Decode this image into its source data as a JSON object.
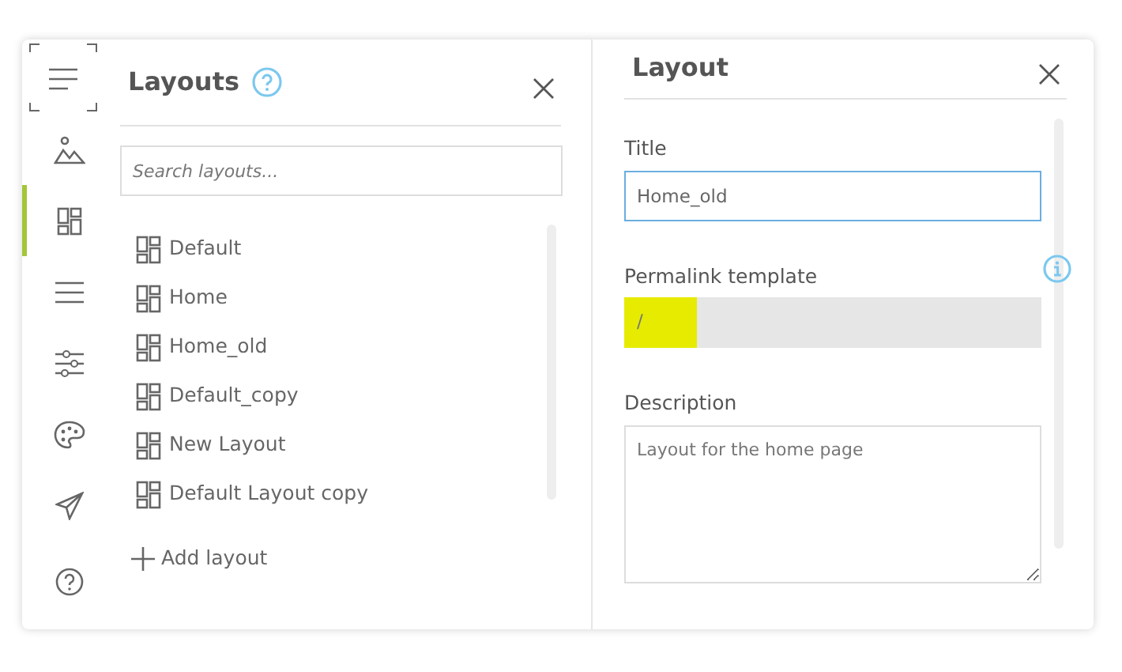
{
  "rail": {
    "items": [
      {
        "kind": "menu",
        "selected": false
      },
      {
        "kind": "image",
        "selected": false
      },
      {
        "kind": "layout",
        "selected": true
      },
      {
        "kind": "lines",
        "selected": false
      },
      {
        "kind": "sliders",
        "selected": false
      },
      {
        "kind": "palette",
        "selected": false
      },
      {
        "kind": "send",
        "selected": false
      },
      {
        "kind": "help",
        "selected": false
      }
    ]
  },
  "layouts_panel": {
    "title": "Layouts",
    "search": {
      "placeholder": "Search layouts..."
    },
    "items": [
      {
        "label": "Default"
      },
      {
        "label": "Home"
      },
      {
        "label": "Home_old"
      },
      {
        "label": "Default_copy"
      },
      {
        "label": "New Layout"
      },
      {
        "label": "Default Layout copy"
      }
    ],
    "add_button": "Add layout"
  },
  "layout_panel": {
    "title": "Layout",
    "fields": [
      {
        "kind": "input",
        "label": "Title",
        "value": "Home_old",
        "focused": true
      },
      {
        "kind": "readonly",
        "label": "Permalink template",
        "value": "/",
        "info": true,
        "highlighted": true
      },
      {
        "kind": "textarea",
        "label": "Description",
        "value": "Layout for the home page"
      }
    ]
  }
}
